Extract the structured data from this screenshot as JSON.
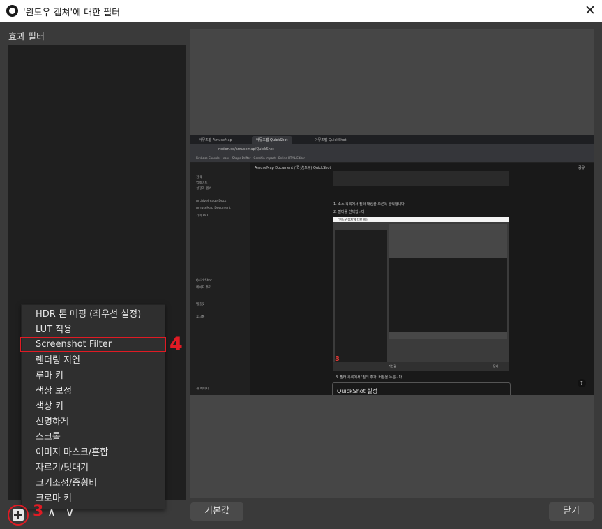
{
  "window": {
    "title": "'윈도우 캡쳐'에 대한 필터",
    "close_symbol": "✕"
  },
  "filters": {
    "section_label": "효과 필터"
  },
  "menu": {
    "items": [
      "HDR 톤 매핑 (최우선 설정)",
      "LUT 적용",
      "Screenshot Filter",
      "렌더링 지연",
      "루마 키",
      "색상 보정",
      "색상 키",
      "선명하게",
      "스크롤",
      "이미지 마스크/혼합",
      "자르기/덧대기",
      "크기조정/종횡비",
      "크로마 키"
    ],
    "highlighted_index": 2
  },
  "annotations": {
    "step4": "4",
    "step3": "3",
    "accent_color": "#e01b24"
  },
  "toolbar": {
    "up_symbol": "∧",
    "down_symbol": "∨"
  },
  "buttons": {
    "defaults": "기본값",
    "close": "닫기"
  },
  "preview": {
    "browser_tabs": [
      "아뮤즈맵 AmuseMap",
      "아뮤즈맵 QuickShot",
      "아뮤즈맵 QuickShot"
    ],
    "url": "notion.so/amusemap/QuickShot",
    "bookmarks": "Firebase Console · Icons · Shape Drifter · Genshin Impact · Online HTML Editor",
    "sidebar": [
      "검색",
      "업데이트",
      "설정과 멤버",
      "ArchiveImage Docs",
      "AmuseMap Document",
      "기획 PPT",
      "QuickShot",
      "페이지 추가",
      "템플릿",
      "휴지통",
      "새 페이지"
    ],
    "breadcrumb": "AmuseMap Document / 퀵샷(도구) QuickShot",
    "share": "공유",
    "step1": "1. 소스 목록에서 필터 대상을 오른쪽 클릭합니다",
    "step2": "2. 필터를 선택합니다",
    "inner_title": "'윈도우 캡쳐'에 대한 필터",
    "inner_defaults": "기본값",
    "inner_close": "닫기",
    "step3_marker": "3",
    "step3_text": "3. 필터 목록에서 '필터 추가' 버튼을 누릅니다",
    "card_title": "QuickShot 설정",
    "help": "?"
  }
}
